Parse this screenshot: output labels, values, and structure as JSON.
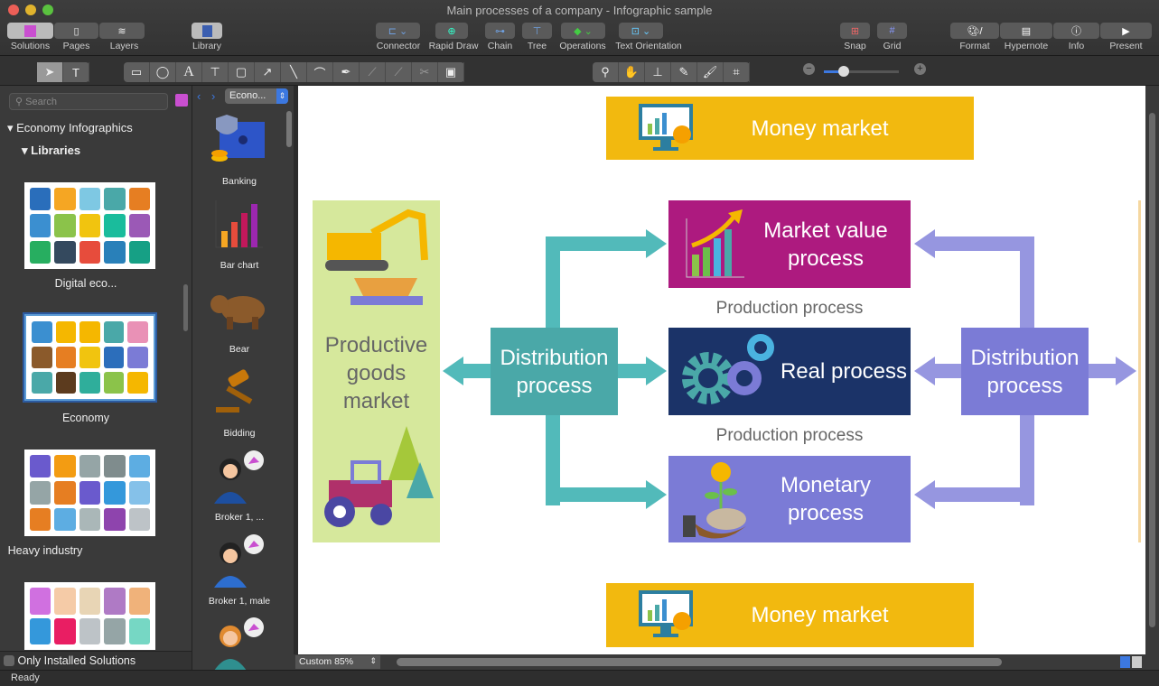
{
  "window": {
    "title": "Main processes of a company - Infographic sample"
  },
  "toolbar": {
    "solutions": "Solutions",
    "pages": "Pages",
    "layers": "Layers",
    "library": "Library",
    "connector": "Connector",
    "rapid_draw": "Rapid Draw",
    "chain": "Chain",
    "tree": "Tree",
    "operations": "Operations",
    "text_orientation": "Text Orientation",
    "snap": "Snap",
    "grid": "Grid",
    "format": "Format",
    "hypernote": "Hypernote",
    "info": "Info",
    "present": "Present"
  },
  "sidebar": {
    "search_placeholder": "Search",
    "section": "Economy Infographics",
    "subsection": "Libraries",
    "libraries": [
      {
        "label": "Digital eco..."
      },
      {
        "label": "Economy"
      },
      {
        "label": "Heavy industry"
      },
      {
        "label": ""
      }
    ],
    "only_installed": "Only Installed Solutions"
  },
  "library": {
    "selector": "Econo...",
    "items": [
      {
        "label": "Banking"
      },
      {
        "label": "Bar chart"
      },
      {
        "label": "Bear"
      },
      {
        "label": "Bidding"
      },
      {
        "label": "Broker 1, ..."
      },
      {
        "label": "Broker 1, male"
      }
    ]
  },
  "diagram": {
    "money_market_top": "Money market",
    "money_market_bottom": "Money market",
    "productive_goods": "Productive goods market",
    "market_value": "Market value process",
    "real": "Real process",
    "monetary": "Monetary process",
    "distribution_left": "Distribution process",
    "distribution_right": "Distribution process",
    "production_1": "Production process",
    "production_2": "Production process",
    "colors": {
      "yellow": "#f2b90f",
      "magenta": "#ad1a7f",
      "navy": "#1b3368",
      "purple": "#7b7bd6",
      "teal": "#4aa8a8",
      "teal_arrow": "#52baba",
      "purple_arrow": "#9696e0",
      "green_panel": "#d6e89c"
    }
  },
  "zoom": {
    "label": "Custom 85%"
  },
  "status": {
    "text": "Ready"
  }
}
